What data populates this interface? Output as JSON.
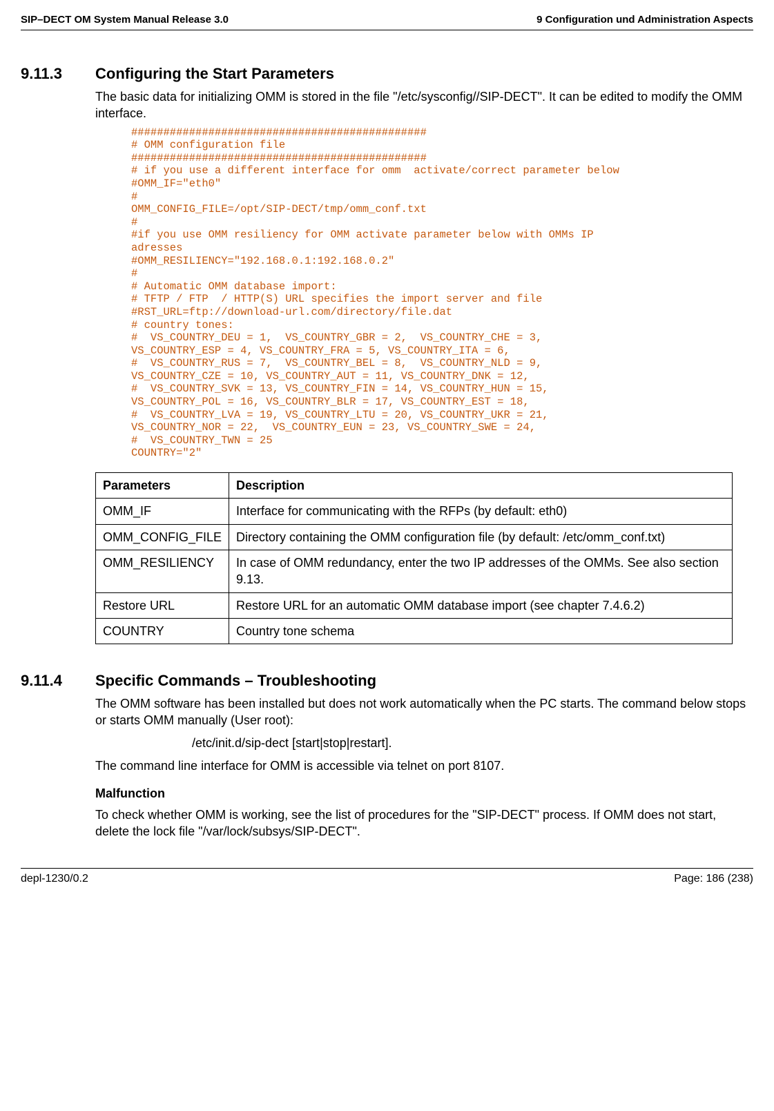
{
  "header": {
    "left": "SIP–DECT OM System Manual Release 3.0",
    "right": "9 Configuration und Administration Aspects"
  },
  "section_9_11_3": {
    "number": "9.11.3",
    "title": "Configuring the Start Parameters",
    "intro": "The basic data for initializing OMM is stored in the file \"/etc/sysconfig//SIP-DECT\". It can be edited to modify the OMM interface.",
    "config_lines": [
      "##############################################",
      "# OMM configuration file",
      "##############################################",
      "# if you use a different interface for omm  activate/correct parameter below",
      "#OMM_IF=\"eth0\"",
      "#",
      "OMM_CONFIG_FILE=/opt/SIP-DECT/tmp/omm_conf.txt",
      "#",
      "#if you use OMM resiliency for OMM activate parameter below with OMMs IP",
      "adresses",
      "#OMM_RESILIENCY=\"192.168.0.1:192.168.0.2\"",
      "#",
      "# Automatic OMM database import:",
      "# TFTP / FTP  / HTTP(S) URL specifies the import server and file",
      "#RST_URL=ftp://download-url.com/directory/file.dat",
      "# country tones:",
      "#  VS_COUNTRY_DEU = 1,  VS_COUNTRY_GBR = 2,  VS_COUNTRY_CHE = 3,",
      "VS_COUNTRY_ESP = 4, VS_COUNTRY_FRA = 5, VS_COUNTRY_ITA = 6,",
      "#  VS_COUNTRY_RUS = 7,  VS_COUNTRY_BEL = 8,  VS_COUNTRY_NLD = 9,",
      "VS_COUNTRY_CZE = 10, VS_COUNTRY_AUT = 11, VS_COUNTRY_DNK = 12,",
      "#  VS_COUNTRY_SVK = 13, VS_COUNTRY_FIN = 14, VS_COUNTRY_HUN = 15,",
      "VS_COUNTRY_POL = 16, VS_COUNTRY_BLR = 17, VS_COUNTRY_EST = 18,",
      "#  VS_COUNTRY_LVA = 19, VS_COUNTRY_LTU = 20, VS_COUNTRY_UKR = 21,",
      "VS_COUNTRY_NOR = 22,  VS_COUNTRY_EUN = 23, VS_COUNTRY_SWE = 24,",
      "#  VS_COUNTRY_TWN = 25",
      "COUNTRY=\"2\""
    ],
    "table": {
      "head": {
        "param": "Parameters",
        "desc": "Description"
      },
      "rows": [
        {
          "param": "OMM_IF",
          "desc": "Interface for communicating with the RFPs (by default: eth0)"
        },
        {
          "param": "OMM_CONFIG_FILE",
          "desc": "Directory containing the OMM configuration file (by default: /etc/omm_conf.txt)"
        },
        {
          "param": "OMM_RESILIENCY",
          "desc": "In case of OMM redundancy, enter the two IP addresses of the OMMs. See also section 9.13."
        },
        {
          "param": "Restore URL",
          "desc": "Restore URL for an automatic OMM database import (see chapter 7.4.6.2)"
        },
        {
          "param": "COUNTRY",
          "desc": "Country tone schema"
        }
      ]
    }
  },
  "section_9_11_4": {
    "number": "9.11.4",
    "title": "Specific Commands – Troubleshooting",
    "p1": "The OMM software has been installed but does not work automatically when the PC starts. The command below stops or starts OMM manually (User root):",
    "cmd": "/etc/init.d/sip-dect [start|stop|restart].",
    "p2": "The command line interface for OMM is accessible via telnet on port 8107.",
    "sub_title": "Malfunction",
    "p3": "To check whether OMM is working, see the list of procedures for the \"SIP-DECT\" process. If OMM does not start, delete the lock file \"/var/lock/subsys/SIP-DECT\"."
  },
  "footer": {
    "left": "depl-1230/0.2",
    "right": "Page: 186 (238)"
  }
}
